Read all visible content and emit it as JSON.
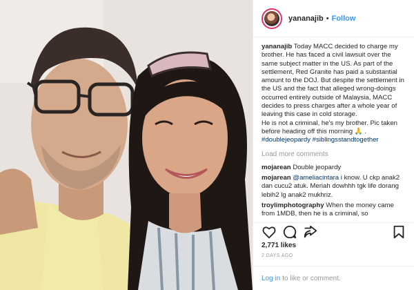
{
  "post": {
    "username": "yananajib",
    "dot": "•",
    "follow_label": "Follow"
  },
  "caption": {
    "username": "yananajib",
    "text": "Today MACC decided to charge my brother. He has faced a civil lawsuit over the same subject matter in the US. As part of the settlement, Red Granite has paid a substantial amount to the DOJ. But despite the settlement in the US and the fact that alleged wrong-doings occurred entirely outside of Malaysia, MACC decides to press charges after a whole year of leaving this case in cold storage.",
    "text2": "He is not a criminal, he's my brother. Pic taken before heading off this morning 🙏 .",
    "tags": "#doublejeopardy #siblingsstandtogether"
  },
  "load_more_label": "Load more comments",
  "comments": [
    {
      "user": "mojarean",
      "text": "Double jeopardy"
    },
    {
      "user": "mojarean",
      "mention": "@ameliacintara",
      "text": " i know. U ckp anak2 dan cucu2 atuk. Meriah dowhhh tgk life dorang lebih2 lg anak2 mukhriz."
    },
    {
      "user": "troylimphotography",
      "text": "When the money came from 1MDB, then he is a criminal, so"
    }
  ],
  "likes": "2,771 likes",
  "date": "2 DAYS AGO",
  "footer": {
    "login_label": "Log in",
    "rest": "to like or comment."
  },
  "colors": {
    "link": "#3897f0",
    "muted": "#999999",
    "border": "#efefef"
  },
  "icons": [
    "heart-icon",
    "comment-icon",
    "share-icon",
    "bookmark-icon"
  ]
}
